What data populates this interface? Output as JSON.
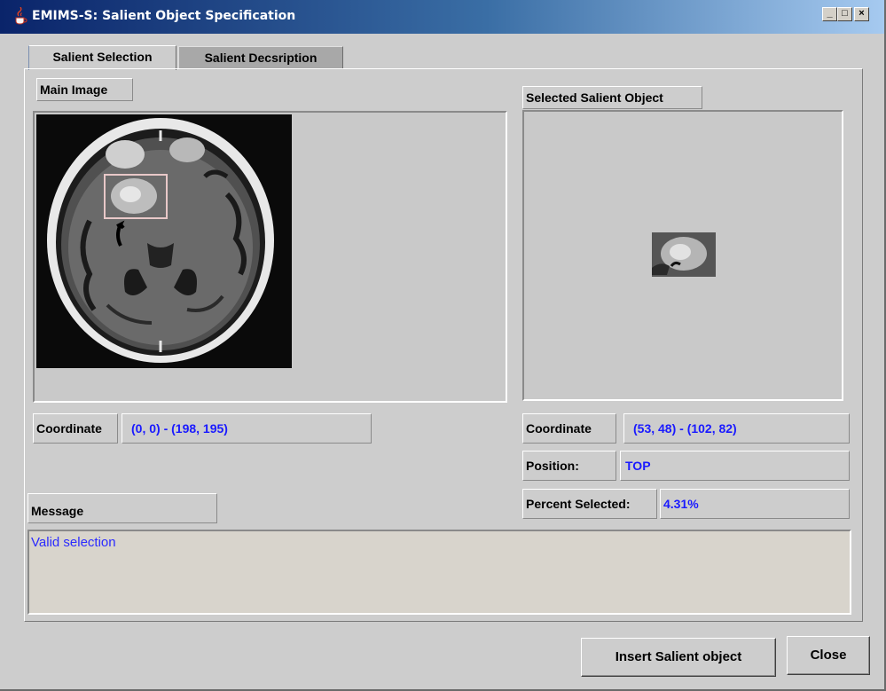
{
  "window": {
    "title": "EMIMS-S: Salient Object Specification",
    "controls": {
      "minimize": "_",
      "maximize": "□",
      "close": "×"
    }
  },
  "tabs": [
    {
      "label": "Salient Selection",
      "active": true
    },
    {
      "label": "Salient Decsription",
      "active": false
    }
  ],
  "main_image": {
    "label": "Main Image",
    "coordinate_label": "Coordinate",
    "coordinate_value": "(0, 0) - (198, 195)"
  },
  "selected_object": {
    "label": "Selected Salient Object",
    "coordinate_label": "Coordinate",
    "coordinate_value": "(53, 48) - (102, 82)",
    "position_label": "Position:",
    "position_value": "TOP",
    "percent_label": "Percent Selected:",
    "percent_value": "4.31%"
  },
  "message": {
    "label": "Message",
    "text": "Valid selection"
  },
  "buttons": {
    "insert": "Insert Salient object",
    "close": "Close"
  },
  "colors": {
    "value_text": "#1a1aff",
    "title_bar": "#0a246a",
    "selection_rect": "#e8c8c8"
  },
  "icons": {
    "app": "java-cup-icon",
    "mri": "brain-mri-image"
  }
}
